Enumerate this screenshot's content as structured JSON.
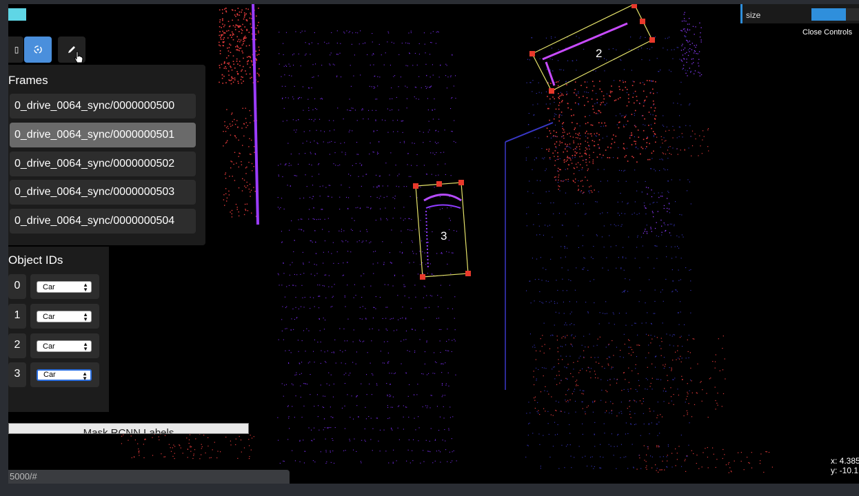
{
  "toolbar": {
    "tools": [
      {
        "icon": "partial-tool-icon"
      },
      {
        "icon": "rotate-tool-icon",
        "active": true
      },
      {
        "icon": "pencil-icon"
      }
    ]
  },
  "frames": {
    "title": "Frames",
    "items": [
      {
        "label": "0_drive_0064_sync/0000000500",
        "selected": false
      },
      {
        "label": "0_drive_0064_sync/0000000501",
        "selected": true
      },
      {
        "label": "0_drive_0064_sync/0000000502",
        "selected": false
      },
      {
        "label": "0_drive_0064_sync/0000000503",
        "selected": false
      },
      {
        "label": "0_drive_0064_sync/0000000504",
        "selected": false
      }
    ]
  },
  "objects": {
    "title": "Object IDs",
    "items": [
      {
        "id": "0",
        "class": "Car"
      },
      {
        "id": "1",
        "class": "Car"
      },
      {
        "id": "2",
        "class": "Car"
      },
      {
        "id": "3",
        "class": "Car",
        "focused": true
      }
    ]
  },
  "mask_button": {
    "label": "Mask RCNN Labels"
  },
  "status_bar": {
    "text": "5000/#"
  },
  "controls": {
    "size_label": "size",
    "size_fraction": 0.7,
    "close_label": "Close Controls"
  },
  "coordinates": {
    "x": "x: 4.385",
    "y": "y: -10.1"
  },
  "boxes": [
    {
      "label": "2"
    },
    {
      "label": "3"
    }
  ],
  "colors": {
    "accent": "#2f8fdc",
    "box_outline": "#e6e36a",
    "box_handle": "#e8392b",
    "points_red": "#e83c3c",
    "points_purple": "#7a2ef0"
  }
}
